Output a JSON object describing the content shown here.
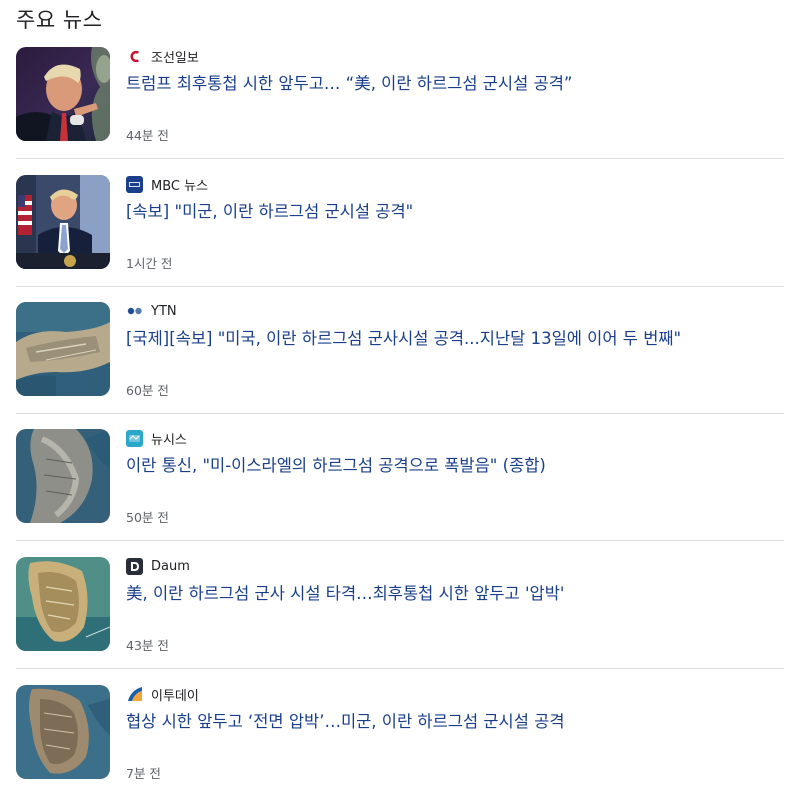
{
  "section": {
    "title": "주요 뉴스"
  },
  "items": [
    {
      "source": "조선일보",
      "source_icon": "chosun-logo-icon",
      "headline": "트럼프 최후통첩 시한 앞두고… “美, 이란 하르그섬 군시설 공격”",
      "time": "44분 전",
      "thumbnail": "trump-portrait-thumbnail"
    },
    {
      "source": "MBC 뉴스",
      "source_icon": "mbc-logo-icon",
      "headline": "[속보] \"미군, 이란 하르그섬 군시설 공격\"",
      "time": "1시간 전",
      "thumbnail": "trump-podium-thumbnail"
    },
    {
      "source": "YTN",
      "source_icon": "ytn-logo-icon",
      "headline": "[국제][속보] \"미국, 이란 하르그섬 군사시설 공격...지난달 13일에 이어 두 번째\"",
      "time": "60분 전",
      "thumbnail": "satellite-island-thumbnail"
    },
    {
      "source": "뉴시스",
      "source_icon": "newsis-logo-icon",
      "headline": "이란 통신, \"미-이스라엘의 하르그섬 공격으로 폭발음\" (종합)",
      "time": "50분 전",
      "thumbnail": "satellite-island-thumbnail"
    },
    {
      "source": "Daum",
      "source_icon": "daum-logo-icon",
      "headline": "美, 이란 하르그섬 군사 시설 타격…최후통첩 시한 앞두고 '압박'",
      "time": "43분 전",
      "thumbnail": "satellite-island-thumbnail"
    },
    {
      "source": "이투데이",
      "source_icon": "etoday-logo-icon",
      "headline": "협상 시한 앞두고 ‘전면 압박’…미군, 이란 하르그섬 군시설 공격",
      "time": "7분 전",
      "thumbnail": "satellite-island-thumbnail"
    }
  ],
  "colors": {
    "headline": "#1a3f8a",
    "time": "#5f6368",
    "divider": "#dadce0",
    "chosun_logo": "#c8102e",
    "mbc_logo": "#1c3f8c",
    "ytn_logo": "#1f4e96",
    "newsis_logo": "#2aa7c9",
    "daum_logo": "#2a2d3a",
    "etoday_logo": "#1b5fa8"
  }
}
